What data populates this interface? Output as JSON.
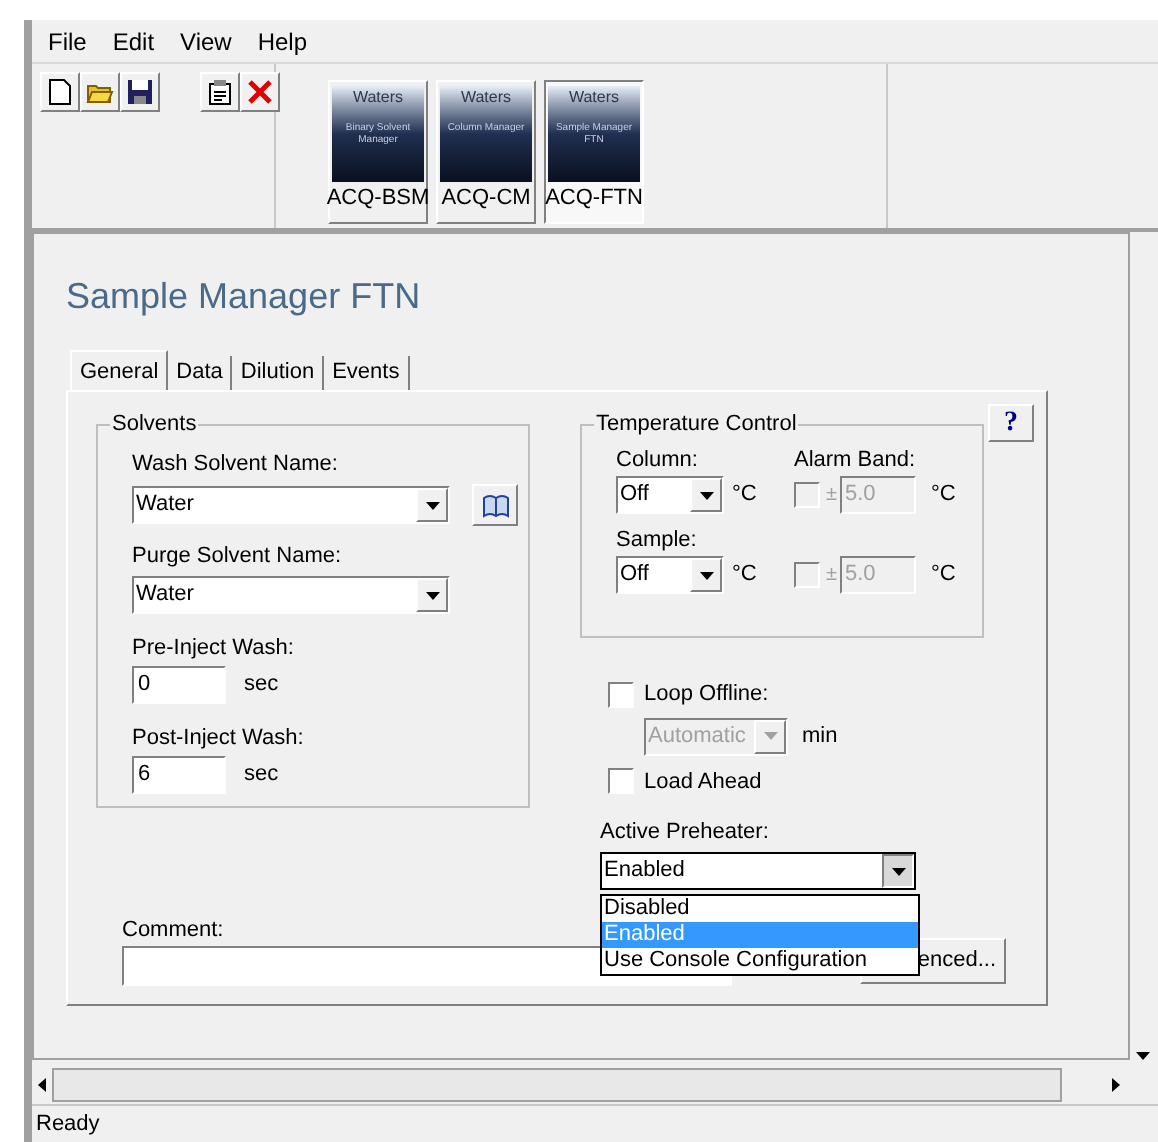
{
  "menu": [
    "File",
    "Edit",
    "View",
    "Help"
  ],
  "modules": [
    {
      "brand": "Waters",
      "caption": "Binary Solvent Manager",
      "label": "ACQ-BSM",
      "selected": false
    },
    {
      "brand": "Waters",
      "caption": "Column Manager",
      "label": "ACQ-CM",
      "selected": false
    },
    {
      "brand": "Waters",
      "caption": "Sample Manager FTN",
      "label": "ACQ-FTN",
      "selected": true
    }
  ],
  "page": {
    "title": "Sample Manager FTN",
    "tabs": [
      {
        "label": "General",
        "selected": true
      },
      {
        "label": "Data",
        "selected": false
      },
      {
        "label": "Dilution",
        "selected": false
      },
      {
        "label": "Events",
        "selected": false
      }
    ],
    "help_button": "?",
    "solvents": {
      "title": "Solvents",
      "wash_label": "Wash Solvent Name:",
      "wash_value": "Water",
      "purge_label": "Purge Solvent Name:",
      "purge_value": "Water",
      "washes": [
        {
          "label": "Pre-Inject Wash:",
          "value": "0",
          "unit": "sec"
        },
        {
          "label": "Post-Inject Wash:",
          "value": "6",
          "unit": "sec"
        }
      ]
    },
    "temperature": {
      "title": "Temperature Control",
      "alarm_label": "Alarm Band:",
      "rows": [
        {
          "label": "Column:",
          "value": "Off",
          "unit": "°C",
          "alarm_checked": false,
          "alarm_sign": "±",
          "alarm_value": "5.0",
          "alarm_unit": "°C"
        },
        {
          "label": "Sample:",
          "value": "Off",
          "unit": "°C",
          "alarm_checked": false,
          "alarm_sign": "±",
          "alarm_value": "5.0",
          "alarm_unit": "°C"
        }
      ]
    },
    "loop_offline": {
      "label": "Loop Offline:",
      "checked": false,
      "mode": "Automatic",
      "mode_disabled": true,
      "unit": "min"
    },
    "load_ahead": {
      "label": "Load Ahead",
      "checked": false
    },
    "active_preheater": {
      "label": "Active Preheater:",
      "value": "Enabled",
      "expanded": true,
      "options": [
        {
          "label": "Disabled",
          "selected": false
        },
        {
          "label": "Enabled",
          "selected": true
        },
        {
          "label": "Use Console Configuration",
          "selected": false
        }
      ]
    },
    "comment": {
      "label": "Comment:"
    },
    "advanced_button": "enced..."
  },
  "status_bar": "Ready"
}
